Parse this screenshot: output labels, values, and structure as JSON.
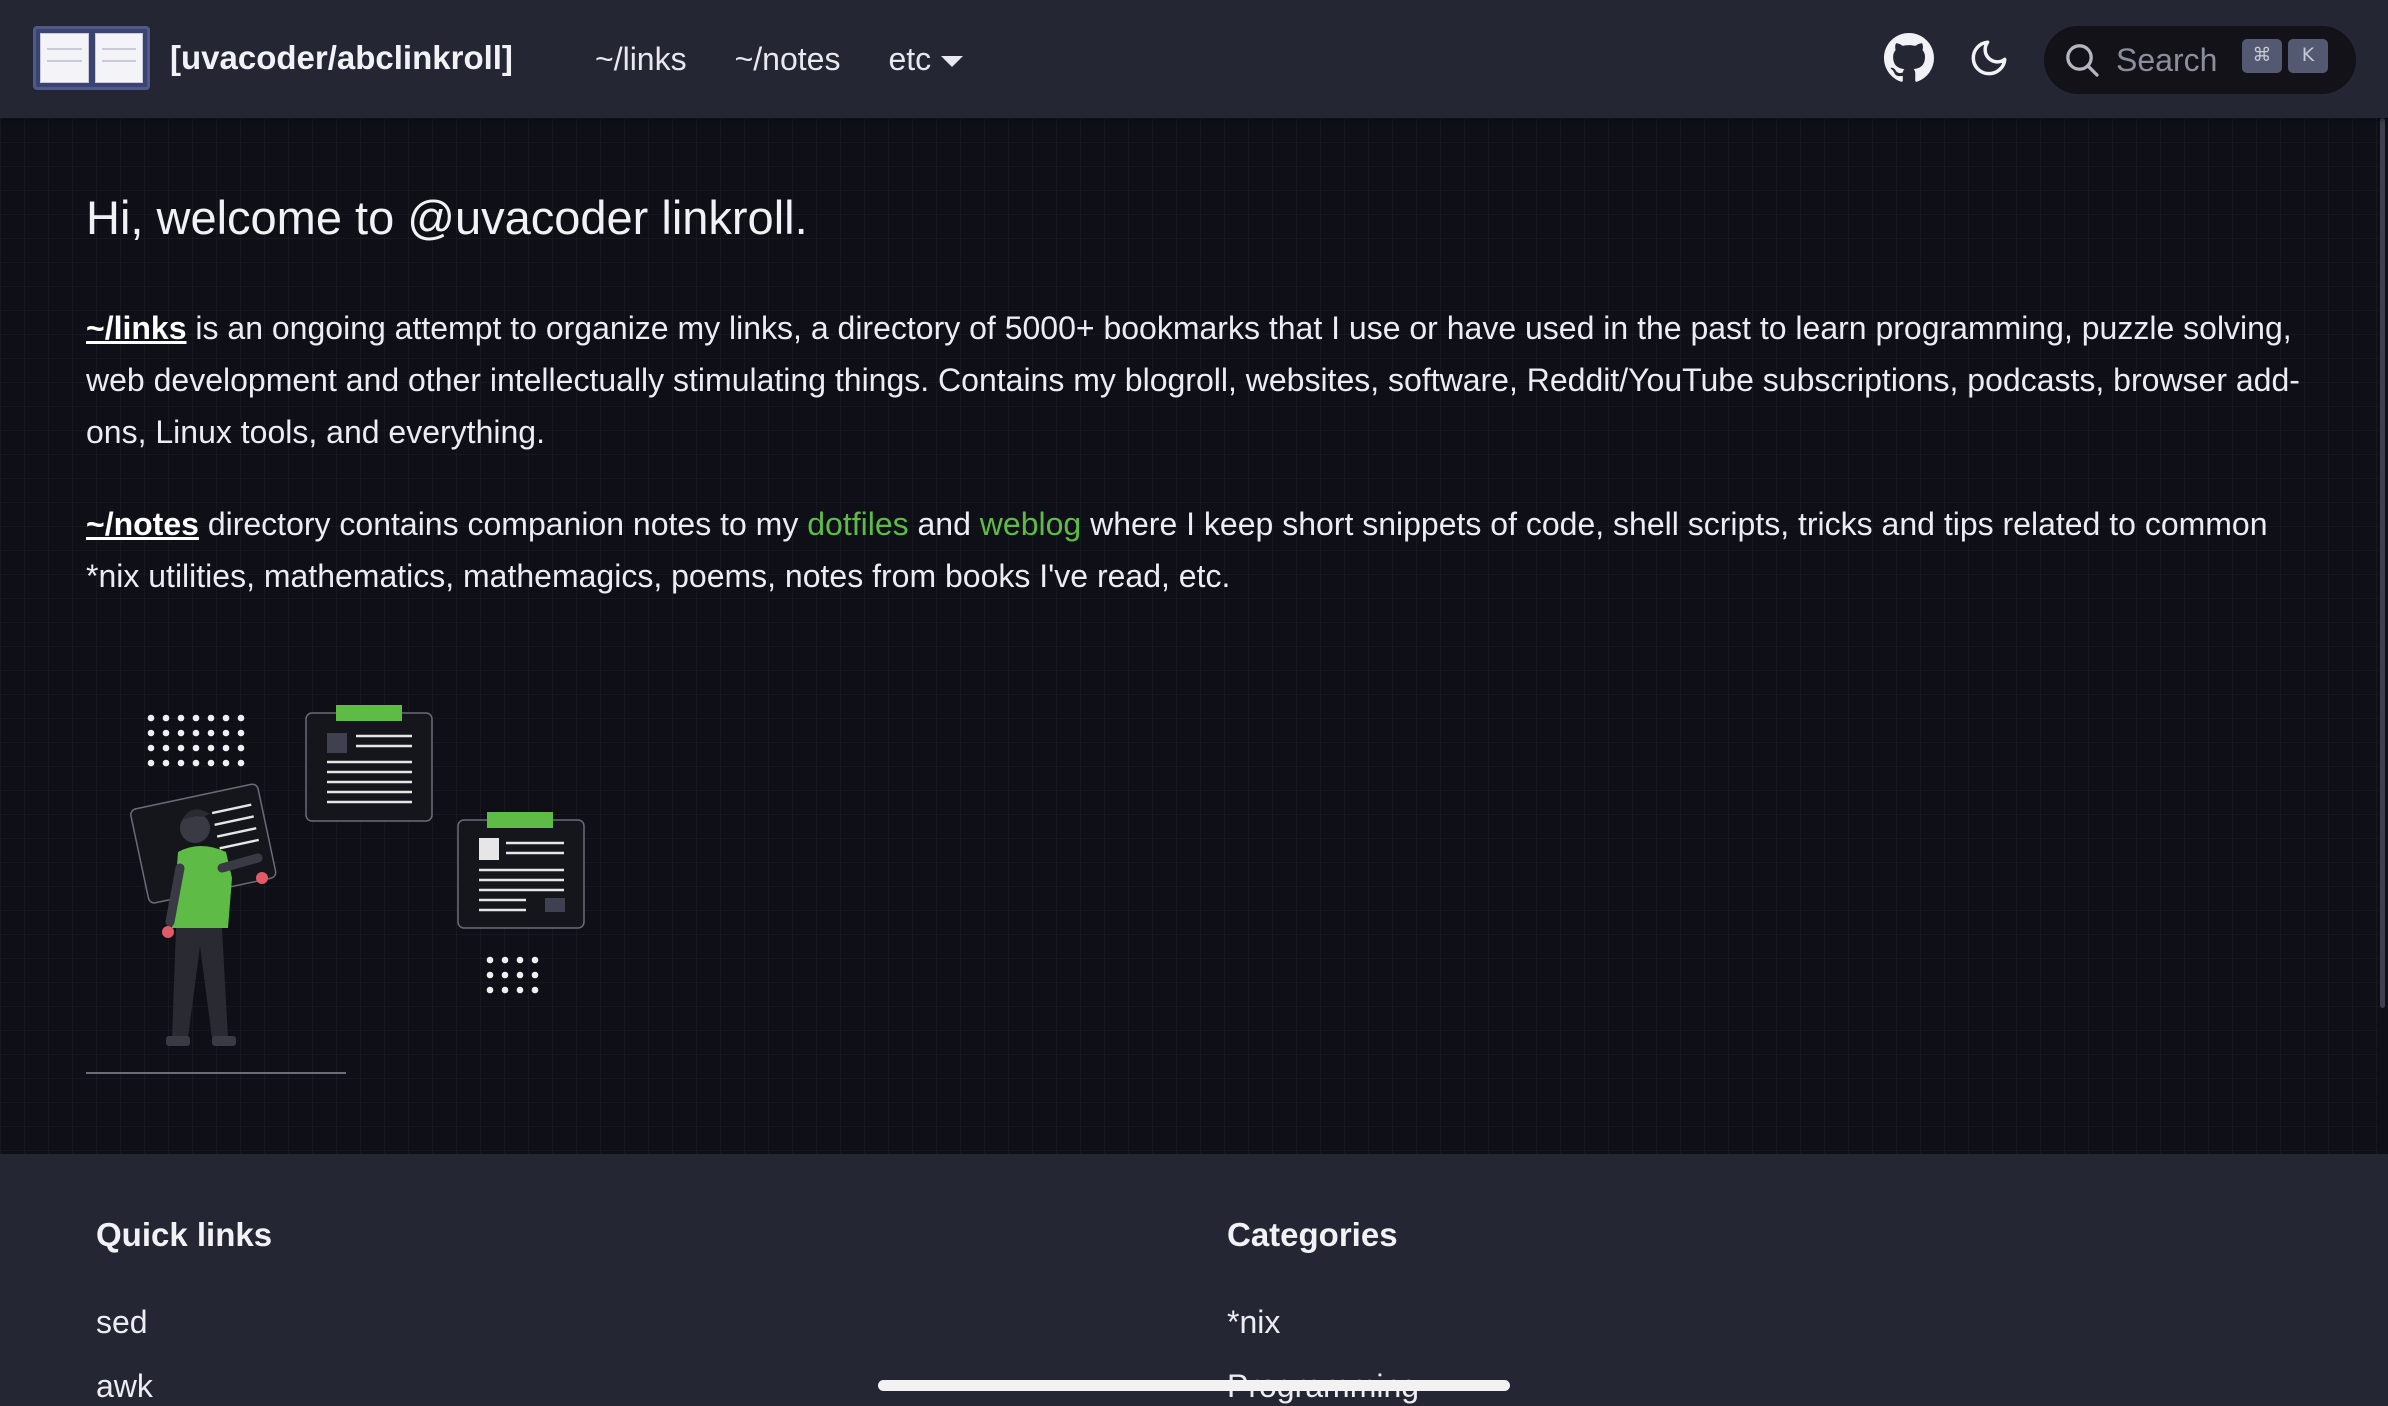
{
  "header": {
    "brand_title": "[uvacoder/abclinkroll]",
    "nav": [
      {
        "label": "~/links"
      },
      {
        "label": "~/notes"
      },
      {
        "label": "etc"
      }
    ],
    "icons": {
      "github": "github-icon",
      "theme": "moon-icon",
      "search": "search-icon"
    },
    "search": {
      "placeholder": "Search",
      "shortcut_mod": "⌘",
      "shortcut_key": "K"
    }
  },
  "main": {
    "title": "Hi, welcome to @uvacoder linkroll.",
    "para1": {
      "link": "~/links",
      "text": " is an ongoing attempt to organize my links, a directory of 5000+ bookmarks that I use or have used in the past to learn programming, puzzle solving, web development and other intellectually stimulating things. Contains my blogroll, websites, software, Reddit/YouTube subscriptions, podcasts, browser add-ons, Linux tools, and everything."
    },
    "para2": {
      "link": "~/notes",
      "text_a": " directory contains companion notes to my ",
      "link_dotfiles": "dotfiles",
      "text_b": " and ",
      "link_weblog": "weblog",
      "text_c": " where I keep short snippets of code, shell scripts, tricks and tips related to common *nix utilities, mathematics, mathemagics, poems, notes from books I've read, etc."
    }
  },
  "footer": {
    "quick_links": {
      "heading": "Quick links",
      "items": [
        "sed",
        "awk"
      ]
    },
    "categories": {
      "heading": "Categories",
      "items": [
        "*nix",
        "Programming"
      ]
    }
  },
  "colors": {
    "accent_green": "#5dbb46",
    "navbar_bg": "#242633",
    "page_bg": "#0f0f17"
  }
}
